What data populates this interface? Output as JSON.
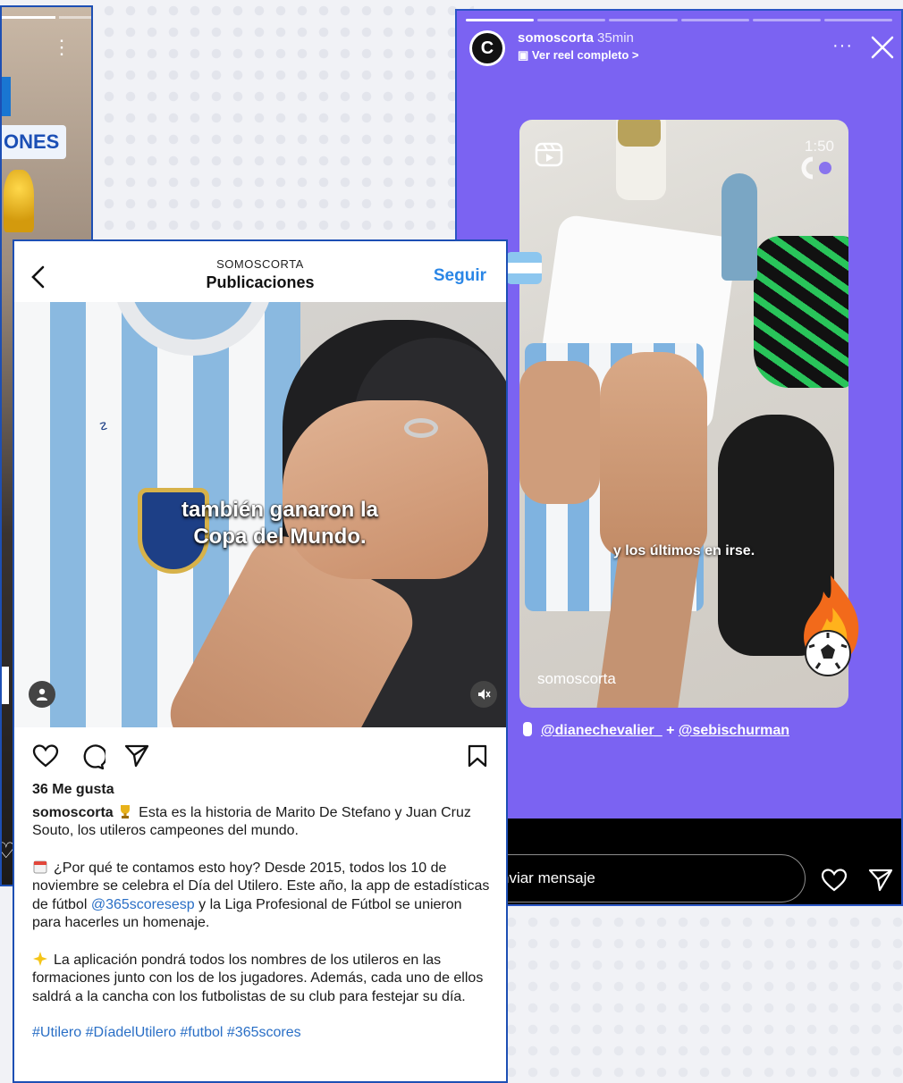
{
  "left_story": {
    "tag_text": "ONES"
  },
  "right_story": {
    "username": "somoscorta",
    "time": "35min",
    "sub_link": "Ver reel completo >",
    "reel": {
      "duration": "1:50",
      "caption": "y los últimos en irse.",
      "watermark": "somoscorta"
    },
    "credits": {
      "user1": "@dianechevalier_",
      "joiner": " + ",
      "user2": "@sebischurman"
    },
    "message_placeholder": "nviar mensaje"
  },
  "post": {
    "account": "SOMOSCORTA",
    "title": "Publicaciones",
    "follow_label": "Seguir",
    "media_caption_line1": "también ganaron la",
    "media_caption_line2": "Copa del Mundo.",
    "likes": "36 Me gusta",
    "username": "somoscorta",
    "caption1": "Esta es la historia de Marito De Stefano y Juan Cruz Souto, los utileros campeones del mundo.",
    "para2_a": "¿Por qué te contamos esto hoy? Desde 2015, todos los 10 de noviembre se celebra el Día del Utilero. Este año, la app de estadísticas de fútbol ",
    "para2_mention": "@365scoresesp",
    "para2_b": " y la Liga Profesional de Fútbol se unieron para hacerles un homenaje.",
    "para3": "La aplicación pondrá todos los nombres de los utileros en las formaciones junto con los de los jugadores. Además, cada uno de ellos saldrá a la cancha con los futbolistas de su club para festejar su día.",
    "hashtags": "#Utilero #DíadelUtilero #futbol #365scores"
  }
}
